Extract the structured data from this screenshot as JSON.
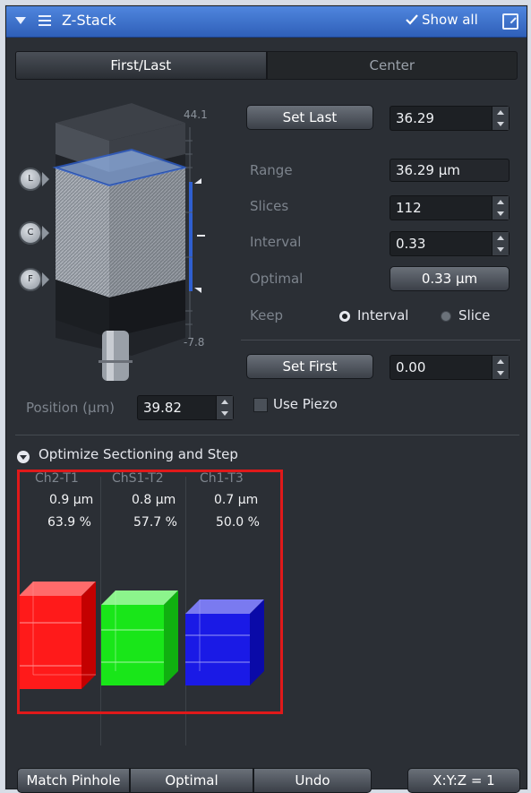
{
  "window": {
    "title": "Z-Stack",
    "show_all_label": "Show all"
  },
  "tabs": [
    {
      "label": "First/Last",
      "active": true
    },
    {
      "label": "Center",
      "active": false
    }
  ],
  "stack_visual": {
    "top_value": "44.1",
    "bottom_value": "-7.8",
    "markers": [
      "L",
      "C",
      "F"
    ]
  },
  "controls": {
    "set_last_label": "Set Last",
    "last_value": "36.29",
    "range_label": "Range",
    "range_value": "36.29 µm",
    "slices_label": "Slices",
    "slices_value": "112",
    "interval_label": "Interval",
    "interval_value": "0.33",
    "optimal_label": "Optimal",
    "optimal_value": "0.33 µm",
    "keep_label": "Keep",
    "keep_options": [
      {
        "label": "Interval",
        "selected": true
      },
      {
        "label": "Slice",
        "selected": false
      }
    ],
    "set_first_label": "Set First",
    "first_value": "0.00",
    "position_label": "Position (µm)",
    "position_value": "39.82",
    "use_piezo_label": "Use Piezo",
    "use_piezo_checked": false
  },
  "optimize": {
    "title": "Optimize Sectioning and Step",
    "channels": [
      {
        "name": "Ch2-T1",
        "thickness": "0.9 µm",
        "percent": "63.9 %",
        "color": "#ff1a1a"
      },
      {
        "name": "ChS1-T2",
        "thickness": "0.8 µm",
        "percent": "57.7 %",
        "color": "#19e619"
      },
      {
        "name": "Ch1-T3",
        "thickness": "0.7 µm",
        "percent": "50.0 %",
        "color": "#1a1ae6"
      }
    ]
  },
  "bottom": {
    "match_pinhole": "Match Pinhole",
    "optimal": "Optimal",
    "undo": "Undo",
    "ratio": "X:Y:Z = 1"
  },
  "colors": {
    "titlebar": "#3a6fcc",
    "panel_bg": "#2b2f35",
    "accent_blue": "#3d6fe0",
    "highlight_red": "#e0191a"
  }
}
